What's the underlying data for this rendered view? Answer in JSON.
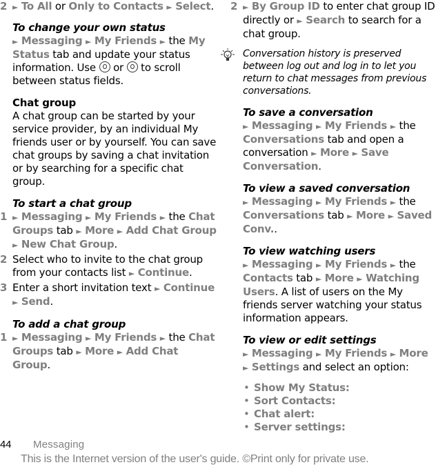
{
  "left": {
    "step2_top": {
      "num": "2",
      "a": "To All",
      "or": " or ",
      "b": "Only to Contacts",
      "c": "Select",
      "end": "."
    },
    "change_status": {
      "heading": "To change your own status",
      "m1": "Messaging",
      "m2": "My Friends",
      "the": " the ",
      "m3": "My Status",
      "t1": " tab and update your status information. Use ",
      "or": " or ",
      "t2": " to scroll between status fields."
    },
    "chat_group": {
      "heading": "Chat group",
      "body": "A chat group can be started by your service provider, by an individual My friends user or by yourself. You can save chat groups by saving a chat invitation or by searching for a specific chat group."
    },
    "start_chat": {
      "heading": "To start a chat group",
      "s1": {
        "num": "1",
        "m1": "Messaging",
        "m2": "My Friends",
        "the": " the ",
        "m3": "Chat Groups",
        "tab": " tab ",
        "m4": "More",
        "m5": "Add Chat Group",
        "m6": "New Chat Group",
        "end": "."
      },
      "s2": {
        "num": "2",
        "text": "Select who to invite to the chat group from your contacts list ",
        "m1": "Continue",
        "end": "."
      },
      "s3": {
        "num": "3",
        "text": "Enter a short invitation text ",
        "m1": "Continue",
        "m2": "Send",
        "end": "."
      }
    },
    "add_chat": {
      "heading": "To add a chat group",
      "s1": {
        "num": "1",
        "m1": "Messaging",
        "m2": "My Friends",
        "the": " the ",
        "m3": "Chat Groups",
        "tab": " tab ",
        "m4": "More",
        "m5": "Add Chat Group",
        "end": "."
      }
    }
  },
  "right": {
    "step2": {
      "num": "2",
      "m1": "By Group ID",
      "t1": " to enter chat group ID directly or ",
      "m2": "Search",
      "t2": " to search for a chat group."
    },
    "tip": "Conversation history is preserved between log out and log in to let you return to chat messages from previous conversations.",
    "save_conv": {
      "heading": "To save a conversation",
      "m1": "Messaging",
      "m2": "My Friends",
      "the": " the ",
      "m3": "Conversations",
      "t1": " tab and open a conversation ",
      "m4": "More",
      "m5": "Save Conversation",
      "end": "."
    },
    "view_saved": {
      "heading": "To view a saved conversation",
      "m1": "Messaging",
      "m2": "My Friends",
      "the": " the ",
      "m3": "Conversations",
      "tab": " tab ",
      "m4": "More",
      "m5": "Saved Conv.",
      "end": "."
    },
    "watching": {
      "heading": "To view watching users",
      "m1": "Messaging",
      "m2": "My Friends",
      "the": " the ",
      "m3": "Contacts",
      "tab": " tab ",
      "m4": "More",
      "m5": "Watching Users",
      "t1": ". A list of users on the My friends server watching your status information appears."
    },
    "settings": {
      "heading": "To view or edit settings",
      "m1": "Messaging",
      "m2": "My Friends",
      "m3": "More",
      "m4": "Settings",
      "t1": " and select an option:",
      "options": [
        "Show My Status:",
        "Sort Contacts:",
        "Chat alert:",
        "Server settings:"
      ]
    }
  },
  "footer": {
    "page_number": "44",
    "section": "Messaging",
    "notice": "This is the Internet version of the user's guide. ©Print only for private use."
  },
  "glyphs": {
    "arrow": "►",
    "bullet": "•"
  }
}
